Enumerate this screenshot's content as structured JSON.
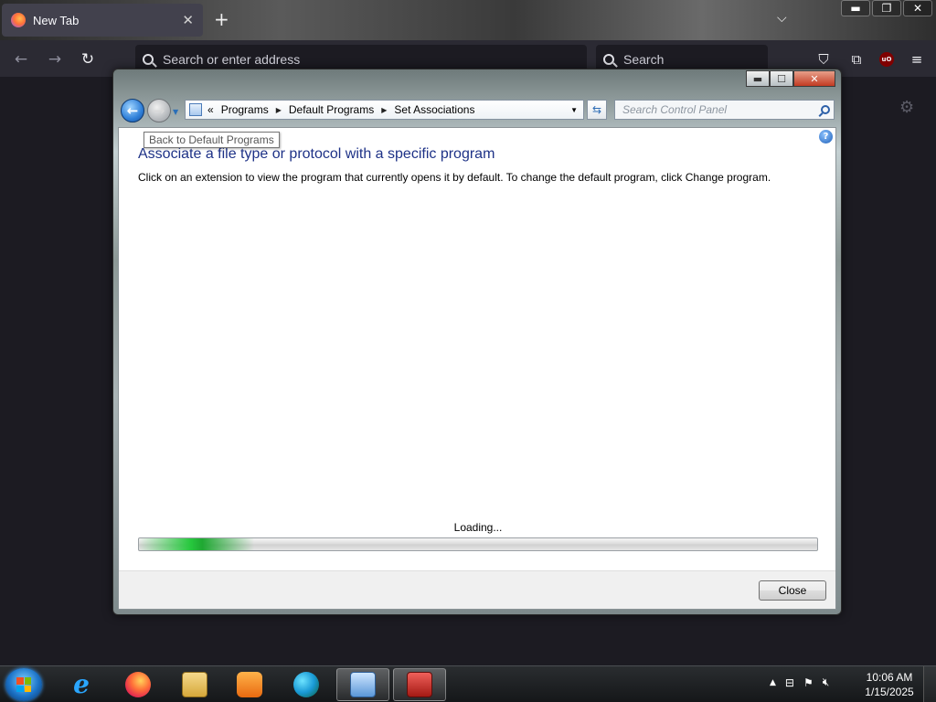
{
  "browser": {
    "tab_title": "New Tab",
    "tab_close": "✕",
    "new_tab": "+",
    "list_all_tabs": "⌵",
    "address_placeholder": "Search or enter address",
    "search_placeholder": "Search",
    "nav": {
      "back": "←",
      "forward": "→",
      "reload": "↻"
    },
    "toolbar_icons": [
      "pocket-icon",
      "extensions-icon",
      "ublock-icon",
      "menu-icon"
    ],
    "ublock_label": "uO",
    "window_controls": {
      "minimize": "▬",
      "restore": "❐",
      "close": "✕"
    }
  },
  "control_panel": {
    "breadcrumb_prefix": "«",
    "breadcrumbs": [
      "Programs",
      "Default Programs",
      "Set Associations"
    ],
    "search_placeholder": "Search Control Panel",
    "tooltip": "Back to Default Programs",
    "heading": "Associate a file type or protocol with a specific program",
    "description": "Click on an extension to view the program that currently opens it by default. To change the default program, click Change program.",
    "loading_text": "Loading...",
    "progress_fraction": 0.17,
    "close_button": "Close",
    "help_label": "?",
    "window_controls": {
      "minimize": "▬",
      "maximize": "☐",
      "close": "✕"
    }
  },
  "taskbar": {
    "pinned": [
      "internet-explorer",
      "firefox",
      "windows-explorer",
      "media-player",
      "edge",
      "control-panel",
      "toolbox"
    ],
    "active": "control-panel",
    "time": "10:06 AM",
    "date": "1/15/2025",
    "tray_icons": [
      "show-hidden-icons",
      "network-icon",
      "action-center-icon",
      "volume-muted-icon"
    ]
  }
}
